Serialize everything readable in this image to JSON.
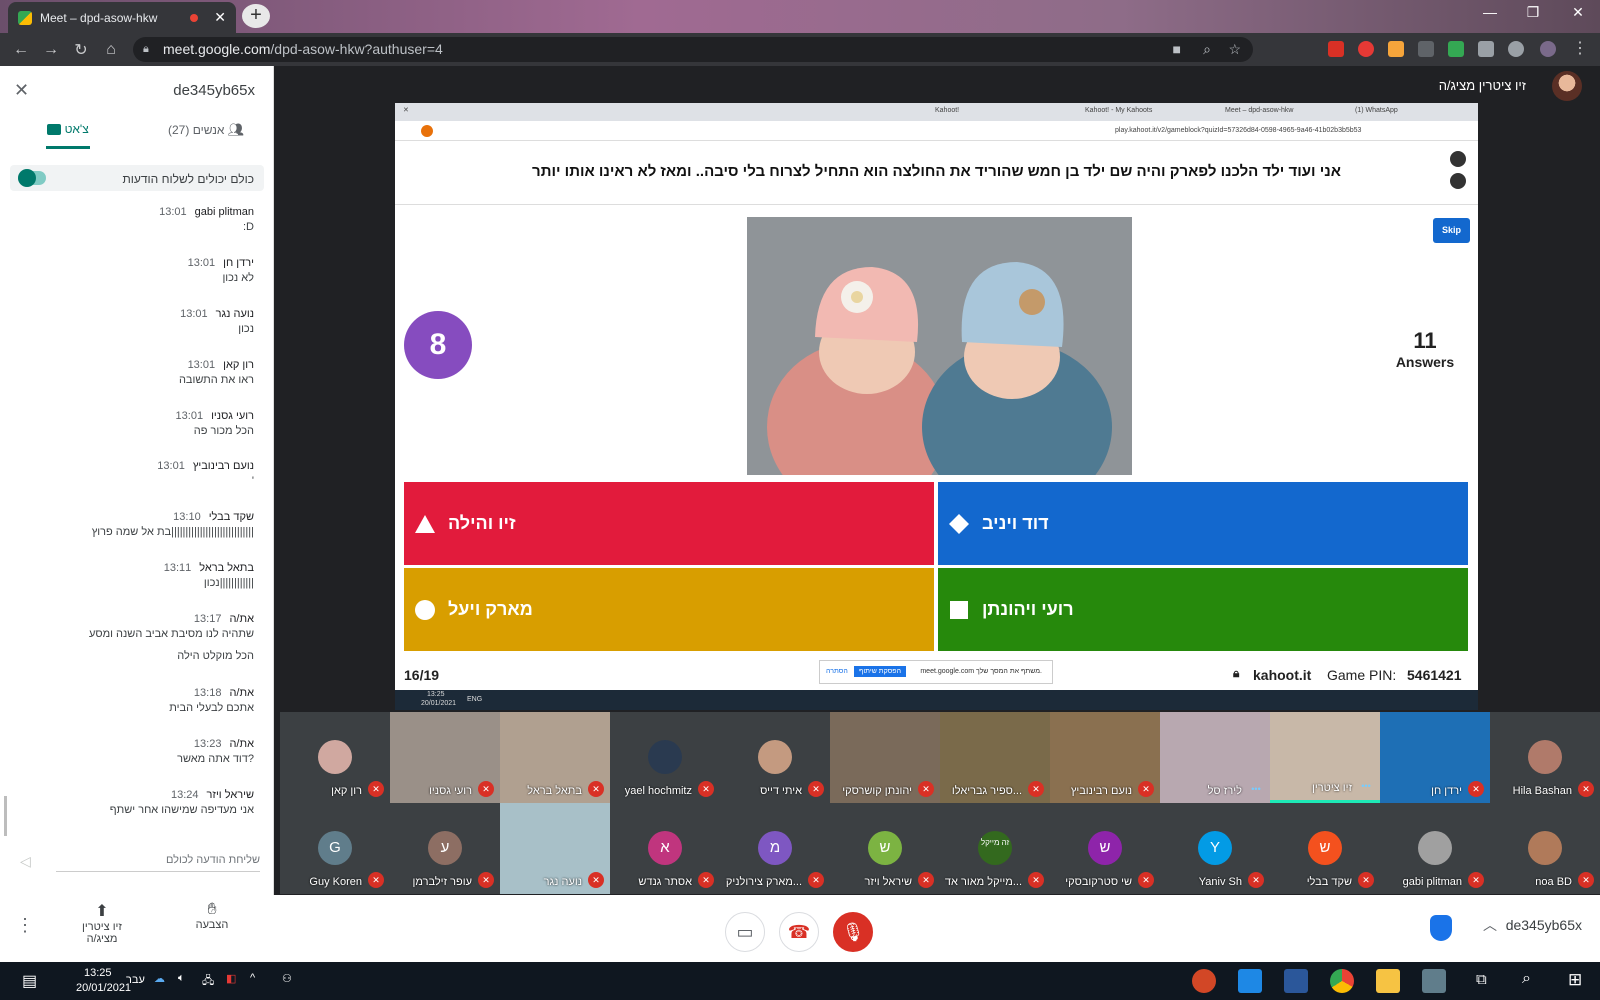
{
  "browser": {
    "tab_title": "Meet – dpd-asow-hkw",
    "url_domain": "meet.google.com",
    "url_path": "/dpd-asow-hkw?authuser=4"
  },
  "panel": {
    "meeting_code": "de345yb65x",
    "tab_chat": "צ'אט",
    "tab_people": "אנשים (27)",
    "toggle_label": "כולם יכולים לשלוח הודעות",
    "messages": [
      {
        "sender": "gabi plitman",
        "time": "13:01",
        "text": ":D"
      },
      {
        "sender": "ירדן חן",
        "time": "13:01",
        "text": "לא נכון"
      },
      {
        "sender": "נועה נגר",
        "time": "13:01",
        "text": "נכון"
      },
      {
        "sender": "רון קאן",
        "time": "13:01",
        "text": "ראו את התשובה"
      },
      {
        "sender": "רועי גסניו",
        "time": "13:01",
        "text": "הכל מכור פה"
      },
      {
        "sender": "נועם רבינוביץ",
        "time": "13:01",
        "text": "'"
      },
      {
        "sender": "שקד בבלי",
        "time": "13:10",
        "text": "בת אל שמה פרוץ|||||||||||||||||||||||||||||"
      },
      {
        "sender": "בתאל בראל",
        "time": "13:11",
        "text": "נכון||||||||||||"
      },
      {
        "sender": "את/ה",
        "time": "13:17",
        "text": "שתהיה לנו מסיבת אביב השנה ומסע",
        "text2": "הכל מוקלט הילה"
      },
      {
        "sender": "את/ה",
        "time": "13:18",
        "text": "אתכם לבעלי הבית"
      },
      {
        "sender": "את/ה",
        "time": "13:23",
        "text": "דוד אתה מאשר?"
      },
      {
        "sender": "שיראל ויזר",
        "time": "13:24",
        "text": "אני מעדיפה שמישהו אחר ישתף"
      }
    ],
    "send_placeholder": "שליחת הודעה לכולם"
  },
  "presenter": {
    "name": "זיו ציטרין מציג/ה"
  },
  "kahoot": {
    "browser_tabs": [
      "Kahoot!",
      "Kahoot! - My Kahoots",
      "Meet – dpd-asow-hkw",
      "(1) WhatsApp"
    ],
    "browser_url": "play.kahoot.it/v2/gameblock?quizId=57326d84-0598-4965-9a46-41b02b3b5b53",
    "question": "אני ועוד ילד הלכנו לפארק והיה שם ילד בן חמש שהוריד את החולצה הוא התחיל לצרוח בלי סיבה.. ומאז לא ראינו אותו יותר",
    "timer": "8",
    "skip": "Skip",
    "answers_count": "11",
    "answers_label": "Answers",
    "answer_red": "זיו והילה",
    "answer_blue": "דוד ויניב",
    "answer_yellow": "מארק ויעל",
    "answer_green": "רועי ויהונתן",
    "progress": "16/19",
    "site": "kahoot.it",
    "pin_label": "Game PIN:",
    "pin": "5461421",
    "share_bar_text": "meet.google.com משתף את המסך שלך.",
    "share_bar_stop": "הפסקת שיתוף",
    "share_bar_hide": "הסתרה",
    "taskbar_time": "13:25",
    "taskbar_date": "20/01/2021",
    "taskbar_lang": "ENG"
  },
  "participants_row1": [
    {
      "name": "Hila Bashan",
      "initial": "",
      "color": "#b07a6a"
    },
    {
      "name": "ירדן חן",
      "initial": "",
      "color": "#1e6fb5"
    },
    {
      "name": "זיו ציטרין",
      "initial": "",
      "color": "#c8b8a8"
    },
    {
      "name": "לירז סל",
      "initial": "",
      "color": "#b8a8b0"
    },
    {
      "name": "נועם רבינוביץ",
      "initial": "",
      "color": "#8a7050"
    },
    {
      "name": "ספיר גבריאלו...",
      "initial": "",
      "color": "#7a6a4a"
    },
    {
      "name": "יהונתן קושרסקי",
      "initial": "",
      "color": "#7a6a5a"
    },
    {
      "name": "איתי דייס",
      "initial": "",
      "color": "#c49a80"
    },
    {
      "name": "yael hochmitz",
      "initial": "",
      "color": "#2a3a50"
    },
    {
      "name": "בתאל בראל",
      "initial": "",
      "color": "#b0a090"
    },
    {
      "name": "רועי גסניו",
      "initial": "",
      "color": "#9a9088"
    },
    {
      "name": "רון קאן",
      "initial": "",
      "color": "#d0a8a0"
    }
  ],
  "participants_row2": [
    {
      "name": "noa BD",
      "initial": "",
      "color": "#b07a5a"
    },
    {
      "name": "gabi plitman",
      "initial": "",
      "color": "#a0a0a0"
    },
    {
      "name": "שקד בבלי",
      "initial": "ש",
      "color": "#f4511e"
    },
    {
      "name": "Yaniv Sh",
      "initial": "Y",
      "color": "#039be5"
    },
    {
      "name": "שי סטרקובסקי",
      "initial": "ש",
      "color": "#8e24aa"
    },
    {
      "name": "מייקל מאור אד...",
      "initial": "זה מייקל",
      "color": "#33691e"
    },
    {
      "name": "שיראל ויזר",
      "initial": "ש",
      "color": "#7cb342"
    },
    {
      "name": "מארק צירולניק...",
      "initial": "מ",
      "color": "#7e57c2"
    },
    {
      "name": "אסתר גנדש",
      "initial": "א",
      "color": "#c0357e"
    },
    {
      "name": "נועה נגר",
      "initial": "",
      "color": "#a8c0c8"
    },
    {
      "name": "עופר זילברמן",
      "initial": "ע",
      "color": "#8d6e63"
    },
    {
      "name": "Guy Koren",
      "initial": "G",
      "color": "#607d8b"
    }
  ],
  "bottombar": {
    "present_label": "זיו ציטרין מציג/ה",
    "hand_label": "הצבעה",
    "meeting_code": "de345yb65x"
  },
  "windows": {
    "time": "13:25",
    "date": "20/01/2021",
    "lang": "עבר"
  }
}
